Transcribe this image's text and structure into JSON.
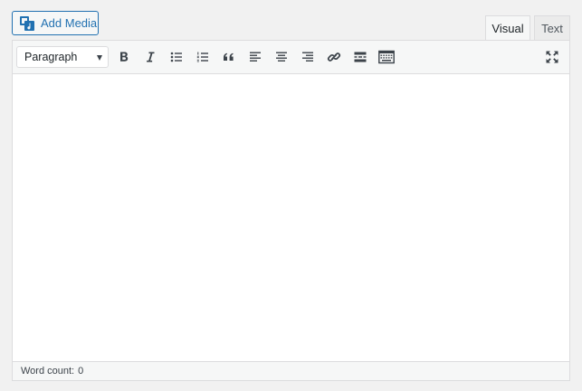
{
  "media": {
    "add_label": "Add Media"
  },
  "tabs": {
    "visual": "Visual",
    "text": "Text"
  },
  "toolbar": {
    "format_value": "Paragraph",
    "icon_color": "#3c434a",
    "buttons": [
      "bold-icon",
      "italic-icon",
      "bulleted-list-icon",
      "numbered-list-icon",
      "blockquote-icon",
      "align-left-icon",
      "align-center-icon",
      "align-right-icon",
      "link-icon",
      "read-more-icon",
      "toolbar-toggle-icon",
      "fullscreen-icon"
    ]
  },
  "status": {
    "word_count_label": "Word count:",
    "word_count_value": "0"
  },
  "colors": {
    "accent": "#2271b1",
    "border": "#dcdcde",
    "toolbar_bg": "#f6f7f7"
  }
}
